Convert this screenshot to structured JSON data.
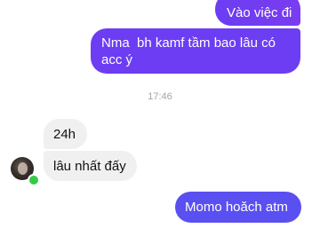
{
  "messages": [
    {
      "sender": "me",
      "text": "Vào việc đi"
    },
    {
      "sender": "me",
      "text": "Nma  bh kamf tầm bao lâu có acc ý"
    },
    {
      "sender": "other",
      "text": "24h"
    },
    {
      "sender": "other",
      "text": "lâu nhất đấy"
    },
    {
      "sender": "me",
      "text": "Momo hoăch atm"
    }
  ],
  "timestamp": "17:46",
  "contact": {
    "status": "online"
  },
  "colors": {
    "outgoing_bubble": "#6c3df3",
    "incoming_bubble": "#f0f0f0",
    "online_dot": "#31cc46"
  }
}
